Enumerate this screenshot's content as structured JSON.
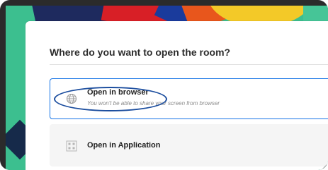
{
  "dialog": {
    "title": "Where do you want to open the room?",
    "options": [
      {
        "label": "Open in browser",
        "description": "You won't be able to share your screen from browser",
        "icon": "globe-icon",
        "selected": true
      },
      {
        "label": "Open in Application",
        "description": "",
        "icon": "app-grid-icon",
        "selected": false
      }
    ]
  },
  "colors": {
    "accent": "#1473e6",
    "highlight_ring": "#1b4d9e",
    "backdrop_green": "#3cbf8f",
    "backdrop_red": "#d81f26",
    "backdrop_yellow": "#f3c928",
    "backdrop_navy": "#1e2a5e"
  }
}
